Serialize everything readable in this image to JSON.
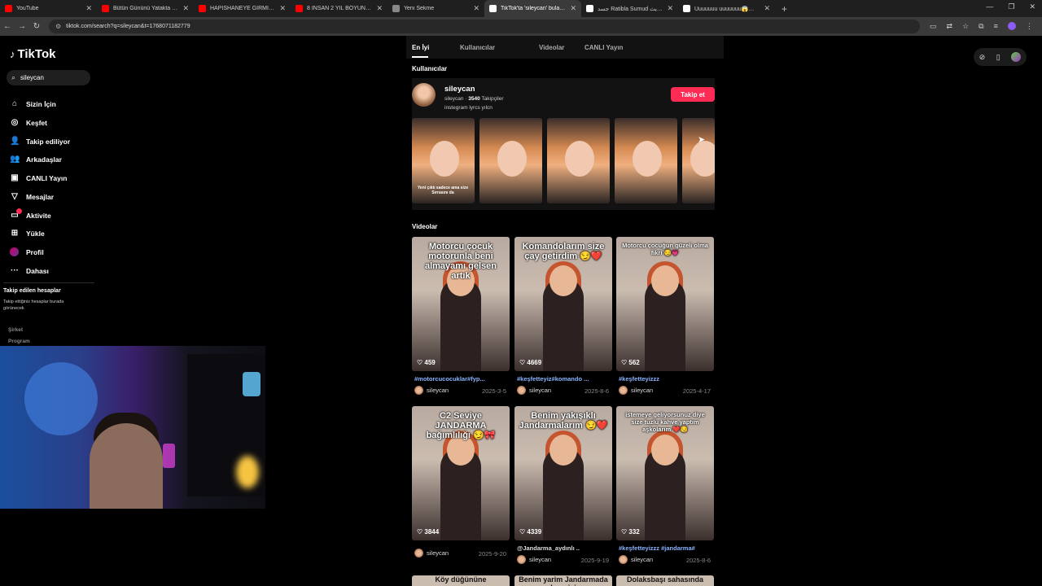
{
  "browser": {
    "tabs": [
      {
        "label": "YouTube",
        "color": "#ff0000",
        "active": false
      },
      {
        "label": "Bütün Gününü Yatakta Geçiriy...",
        "color": "#ff0000",
        "active": false
      },
      {
        "label": "HAPİSHANEYE GİRMİŞ HANIM...",
        "color": "#ff0000",
        "active": false
      },
      {
        "label": "8 İNSAN 2 YIL BOYUNCA BİR M...",
        "color": "#ff0000",
        "active": false
      },
      {
        "label": "Yeni Sekme",
        "color": "#888888",
        "active": false
      },
      {
        "label": "TikTok'ta 'sileycan' bulabilirsin...",
        "color": "#ffffff",
        "active": true
      },
      {
        "label": "جسد Ratibla Sumud جول تحديث",
        "color": "#ffffff",
        "active": false
      },
      {
        "label": "Uuuuuuu uuuuuuu😱😭#10#yi...",
        "color": "#ffffff",
        "active": false
      }
    ],
    "new_tab": "+",
    "url": "tiktok.com/search?q=sileycan&t=1768071182779",
    "window_controls": [
      "—",
      "❐",
      "✕"
    ]
  },
  "sidebar": {
    "logo": "TikTok",
    "search_value": "sileycan",
    "nav": [
      {
        "label": "Sizin İçin",
        "icon": "home-icon",
        "glyph": "⌂"
      },
      {
        "label": "Keşfet",
        "icon": "compass-icon",
        "glyph": "◎"
      },
      {
        "label": "Takip ediliyor",
        "icon": "following-icon",
        "glyph": "👤"
      },
      {
        "label": "Arkadaşlar",
        "icon": "friends-icon",
        "glyph": "👥"
      },
      {
        "label": "CANLI Yayın",
        "icon": "live-icon",
        "glyph": "▣"
      },
      {
        "label": "Mesajlar",
        "icon": "messages-icon",
        "glyph": "▽"
      },
      {
        "label": "Aktivite",
        "icon": "activity-icon",
        "glyph": "▭"
      },
      {
        "label": "Yükle",
        "icon": "upload-icon",
        "glyph": "⊞"
      },
      {
        "label": "Profil",
        "icon": "profile-avatar",
        "glyph": ""
      },
      {
        "label": "Dahası",
        "icon": "more-icon",
        "glyph": "···"
      }
    ],
    "followed_title": "Takip edilen hesaplar",
    "followed_desc": "Takip ettiğiniz hesaplar burada görünecek",
    "footer_company": "Şirket",
    "footer_program": "Program"
  },
  "search_tabs": [
    "En İyi",
    "Kullanıcılar",
    "Videolar",
    "CANLI Yayın"
  ],
  "users_section": {
    "title": "Kullanıcılar",
    "user": {
      "name": "sileycan",
      "handle": "sileycan",
      "followers": "3540",
      "followers_label": "Takipçiler",
      "bio": "instegram lyrcs yılcn",
      "follow_label": "Takip et"
    },
    "thumb_caption": "Yeni çıktı sadece ama size Sırrasını da"
  },
  "videos_section": {
    "title": "Videolar",
    "videos": [
      {
        "caption": "Motorcu çocuk motorunla beni almayamı gelsen artık",
        "likes": "459",
        "desc": "#motorcucocuklar#fyp...",
        "user": "sileycan",
        "date": "2025-3-5"
      },
      {
        "caption": "Komandolarım size çay getirdim 😏❤️",
        "likes": "4669",
        "desc": "#keşfetteyiz#komando ...",
        "user": "sileycan",
        "date": "2025-8-6"
      },
      {
        "caption": "Motorcu çocuğun güzeli olma fikri 😏💗",
        "likes": "562",
        "desc": "#keşfetteyizzz",
        "user": "sileycan",
        "date": "2025-4-17"
      },
      {
        "caption": "C2 Seviye JANDARMA bağımlılığı 😏🎀",
        "likes": "3844",
        "desc": "",
        "user": "sileycan",
        "date": "2025-9-20"
      },
      {
        "caption": "Benim yakışıklı Jandarmalarım 😏❤️",
        "likes": "4339",
        "desc": "@Jandarma_aydınlı ..",
        "user": "sileycan",
        "date": "2025-9-19"
      },
      {
        "caption": "istemeye geliyorsunuz diye size tuzlu kahve yaptım aşkolarım ❤️😏",
        "likes": "332",
        "desc": "#keşfetteyizzz #jandarma#",
        "user": "sileycan",
        "date": "2025-8-6"
      }
    ],
    "bottom_captions": [
      "Köy düğününe",
      "Benim yarim Jandarmada hangisi",
      "Dolaksbaşı sahasında"
    ]
  }
}
